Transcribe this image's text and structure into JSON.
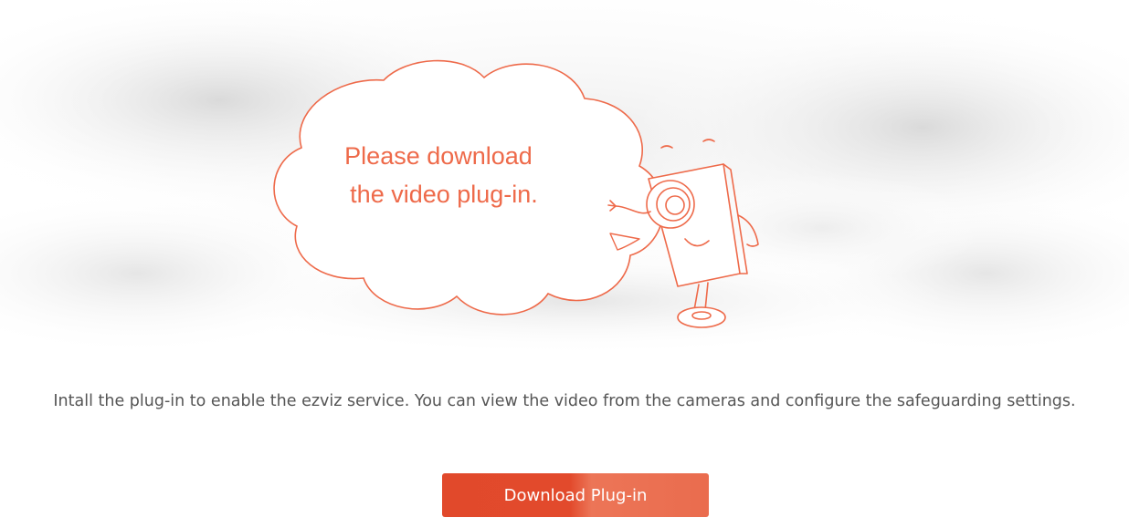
{
  "bubble": {
    "line1": "Please download",
    "line2": "the video plug-in."
  },
  "mascot": {
    "icon": "camera-mascot-icon"
  },
  "description": "Intall the plug-in to enable the ezviz service. You can view the video from the cameras and configure the safeguarding settings.",
  "download_button": {
    "label": "Download Plug-in"
  },
  "colors": {
    "accent": "#E1492B",
    "accent_light": "#EC7557",
    "illustration_line": "#EE6A4A",
    "text": "#555555"
  }
}
